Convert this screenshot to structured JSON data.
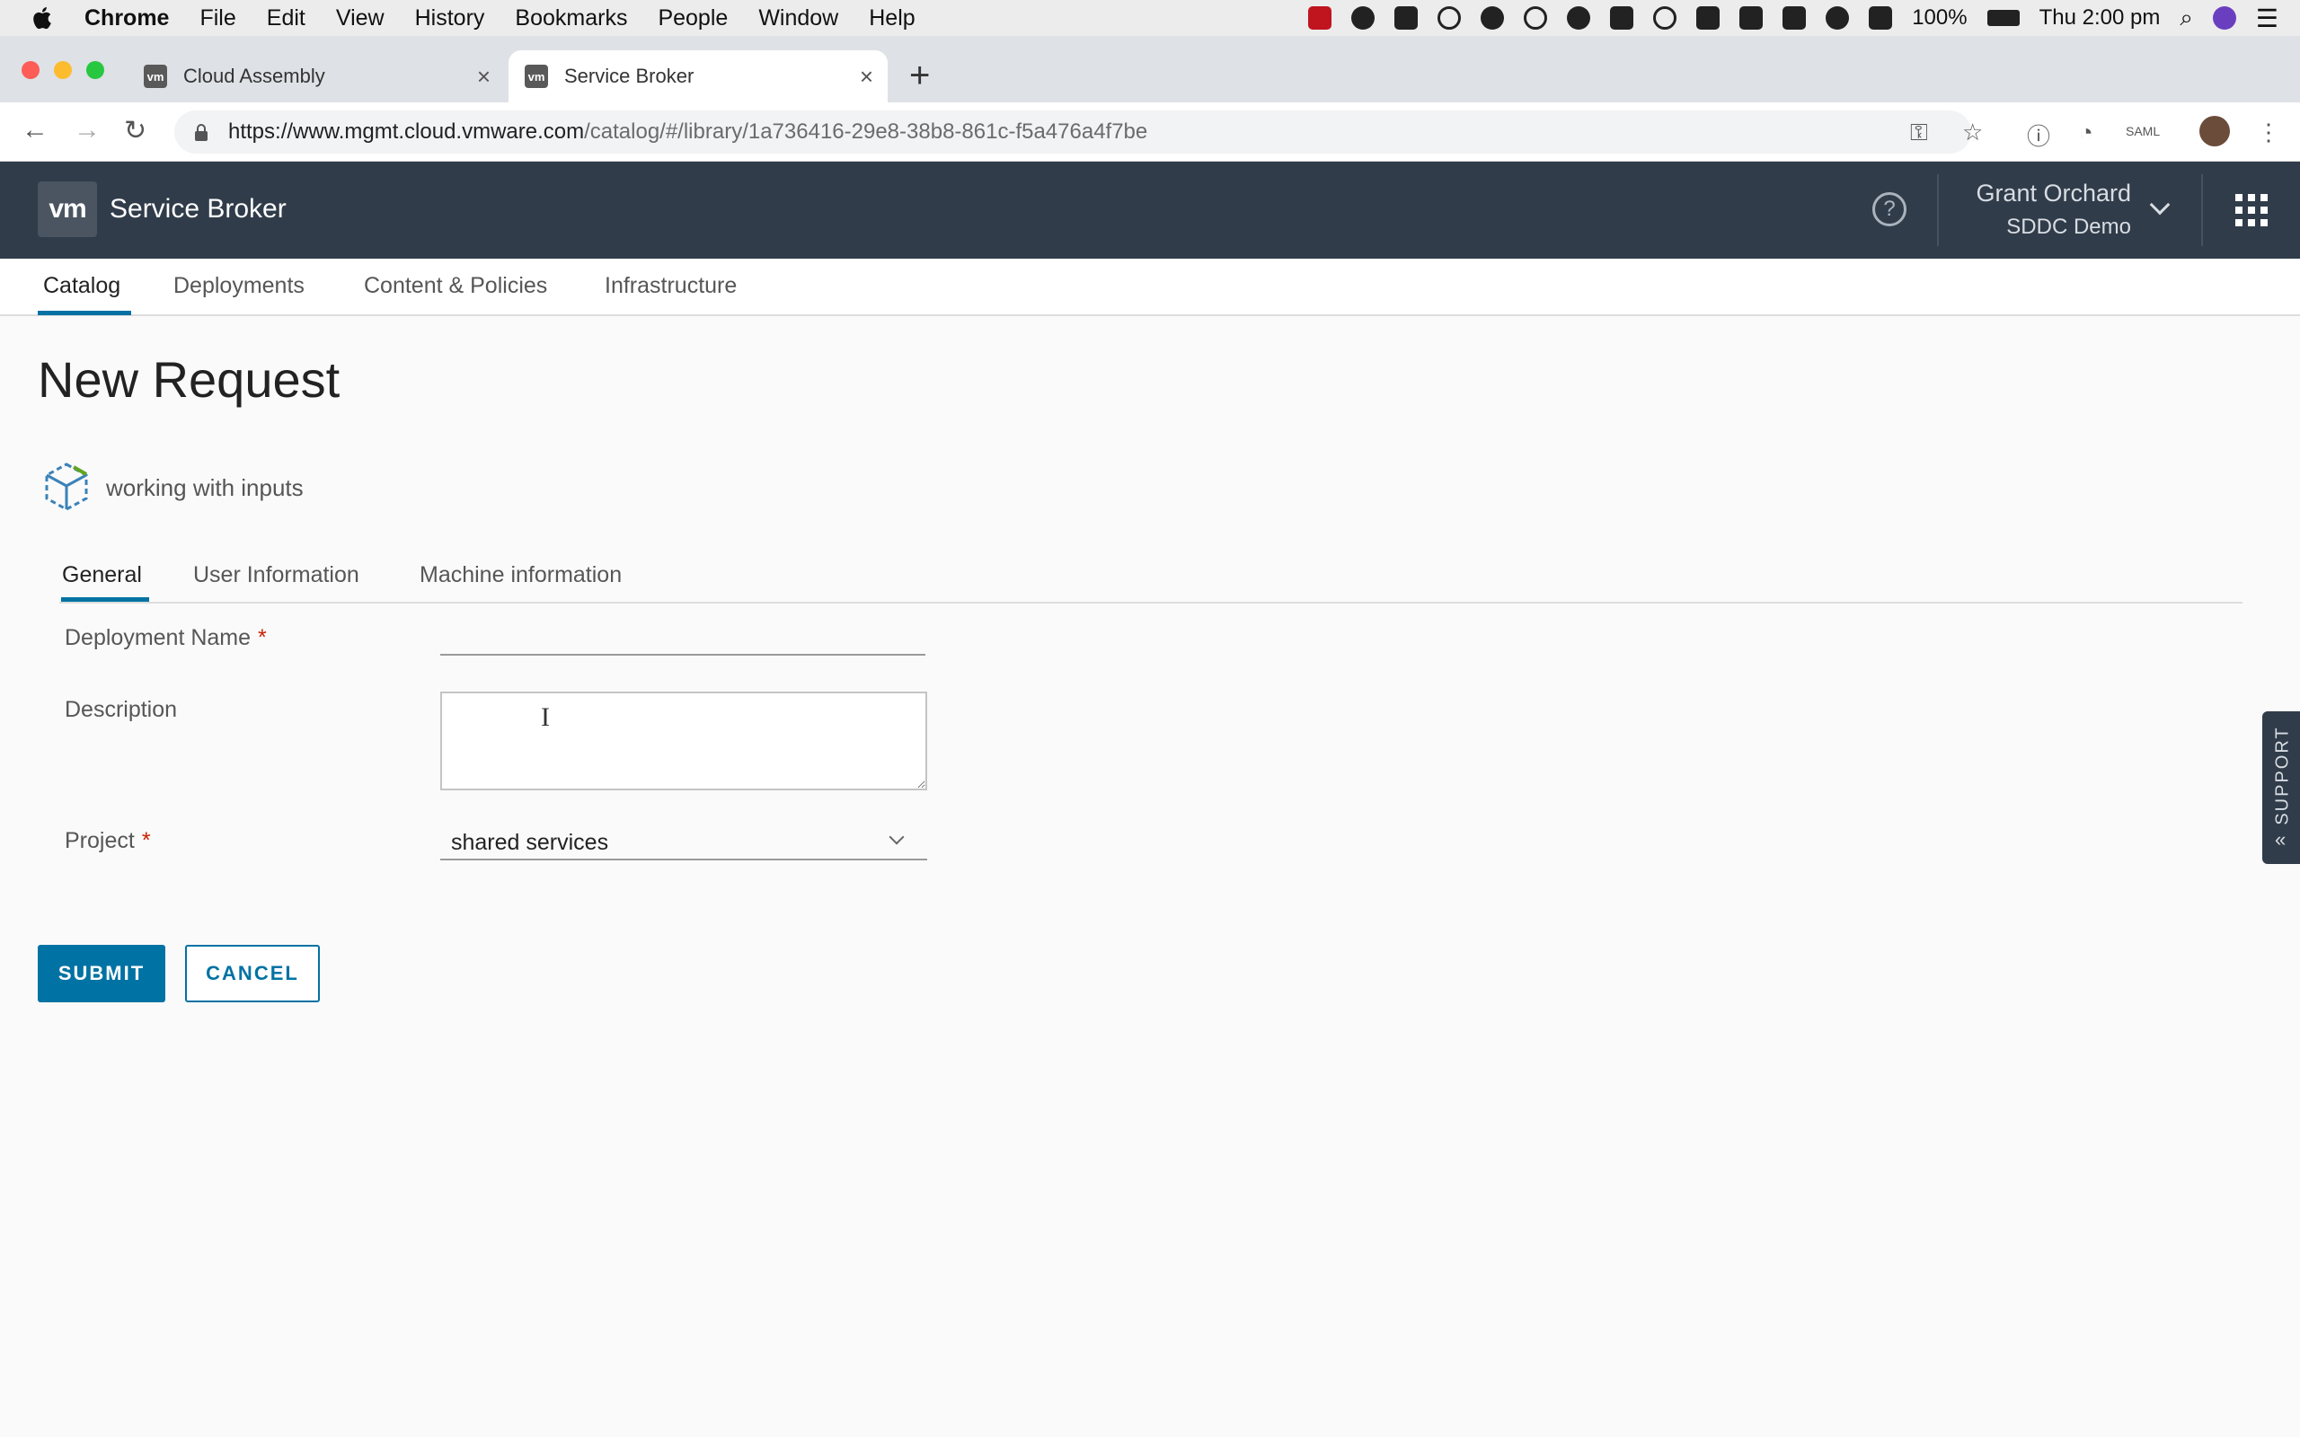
{
  "menubar": {
    "app": "Chrome",
    "items": [
      "File",
      "Edit",
      "View",
      "History",
      "Bookmarks",
      "People",
      "Window",
      "Help"
    ],
    "battery": "100%",
    "clock": "Thu 2:00 pm"
  },
  "browser": {
    "tabs": [
      {
        "title": "Cloud Assembly",
        "favicon": "vm"
      },
      {
        "title": "Service Broker",
        "favicon": "vm"
      }
    ],
    "url_host": "https://www.mgmt.cloud.vmware.com",
    "url_path": "/catalog/#/library/1a736416-29e8-38b8-861c-f5a476a4f7be"
  },
  "header": {
    "logo": "vm",
    "title": "Service Broker",
    "help": "?",
    "user_name": "Grant Orchard",
    "org_name": "SDDC Demo"
  },
  "subnav": {
    "items": [
      "Catalog",
      "Deployments",
      "Content & Policies",
      "Infrastructure"
    ],
    "active": "Catalog"
  },
  "page": {
    "title": "New Request",
    "blueprint_name": "working with inputs"
  },
  "form": {
    "tabs": [
      "General",
      "User Information",
      "Machine information"
    ],
    "deployment_name_label": "Deployment Name",
    "deployment_name_value": "",
    "description_label": "Description",
    "description_value": "",
    "project_label": "Project",
    "project_value": "shared services",
    "required_mark": "*"
  },
  "actions": {
    "submit": "SUBMIT",
    "cancel": "CANCEL"
  },
  "support": {
    "label": "SUPPORT"
  },
  "colors": {
    "header_bg": "#313c4a",
    "accent": "#0072a3",
    "required": "#c92100"
  }
}
